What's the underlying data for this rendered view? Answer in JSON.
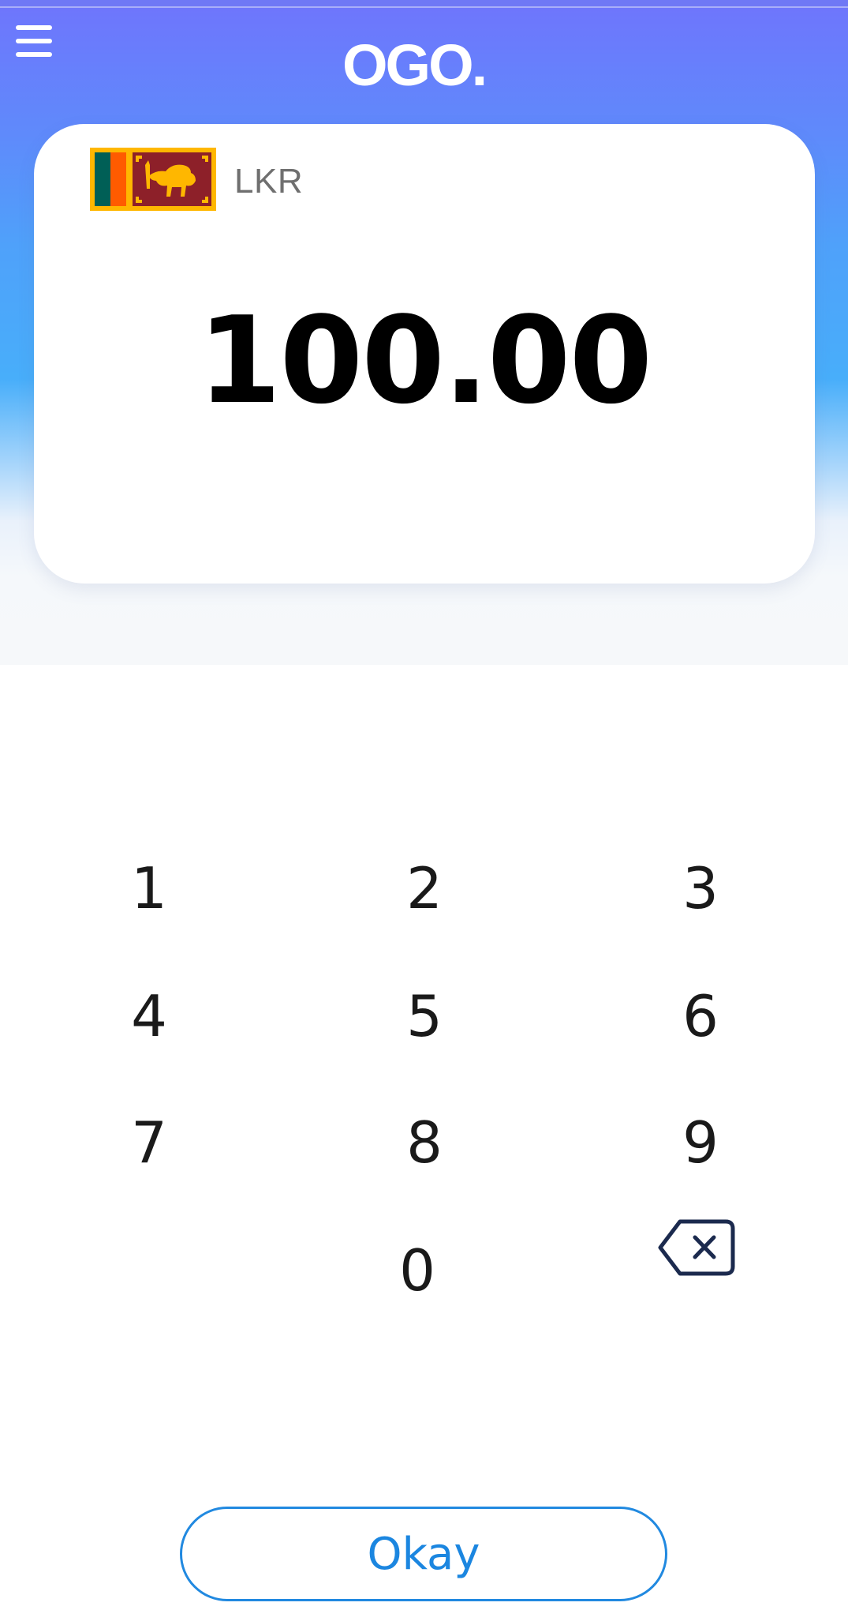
{
  "app": {
    "logo_text": "OGO."
  },
  "header": {
    "menu_icon": "hamburger-menu-icon"
  },
  "amount_card": {
    "currency_code": "LKR",
    "flag_icon": "sri-lanka-flag-icon",
    "amount": "100.00"
  },
  "keypad": {
    "keys": [
      "1",
      "2",
      "3",
      "4",
      "5",
      "6",
      "7",
      "8",
      "9",
      "0"
    ],
    "backspace_icon": "backspace-icon"
  },
  "actions": {
    "okay_label": "Okay"
  },
  "colors": {
    "header_gradient_top": "#6e76fc",
    "header_gradient_mid": "#48aefa",
    "card_background": "#ffffff",
    "accent_blue": "#1b86e0",
    "backspace_stroke": "#1b2a4e"
  }
}
